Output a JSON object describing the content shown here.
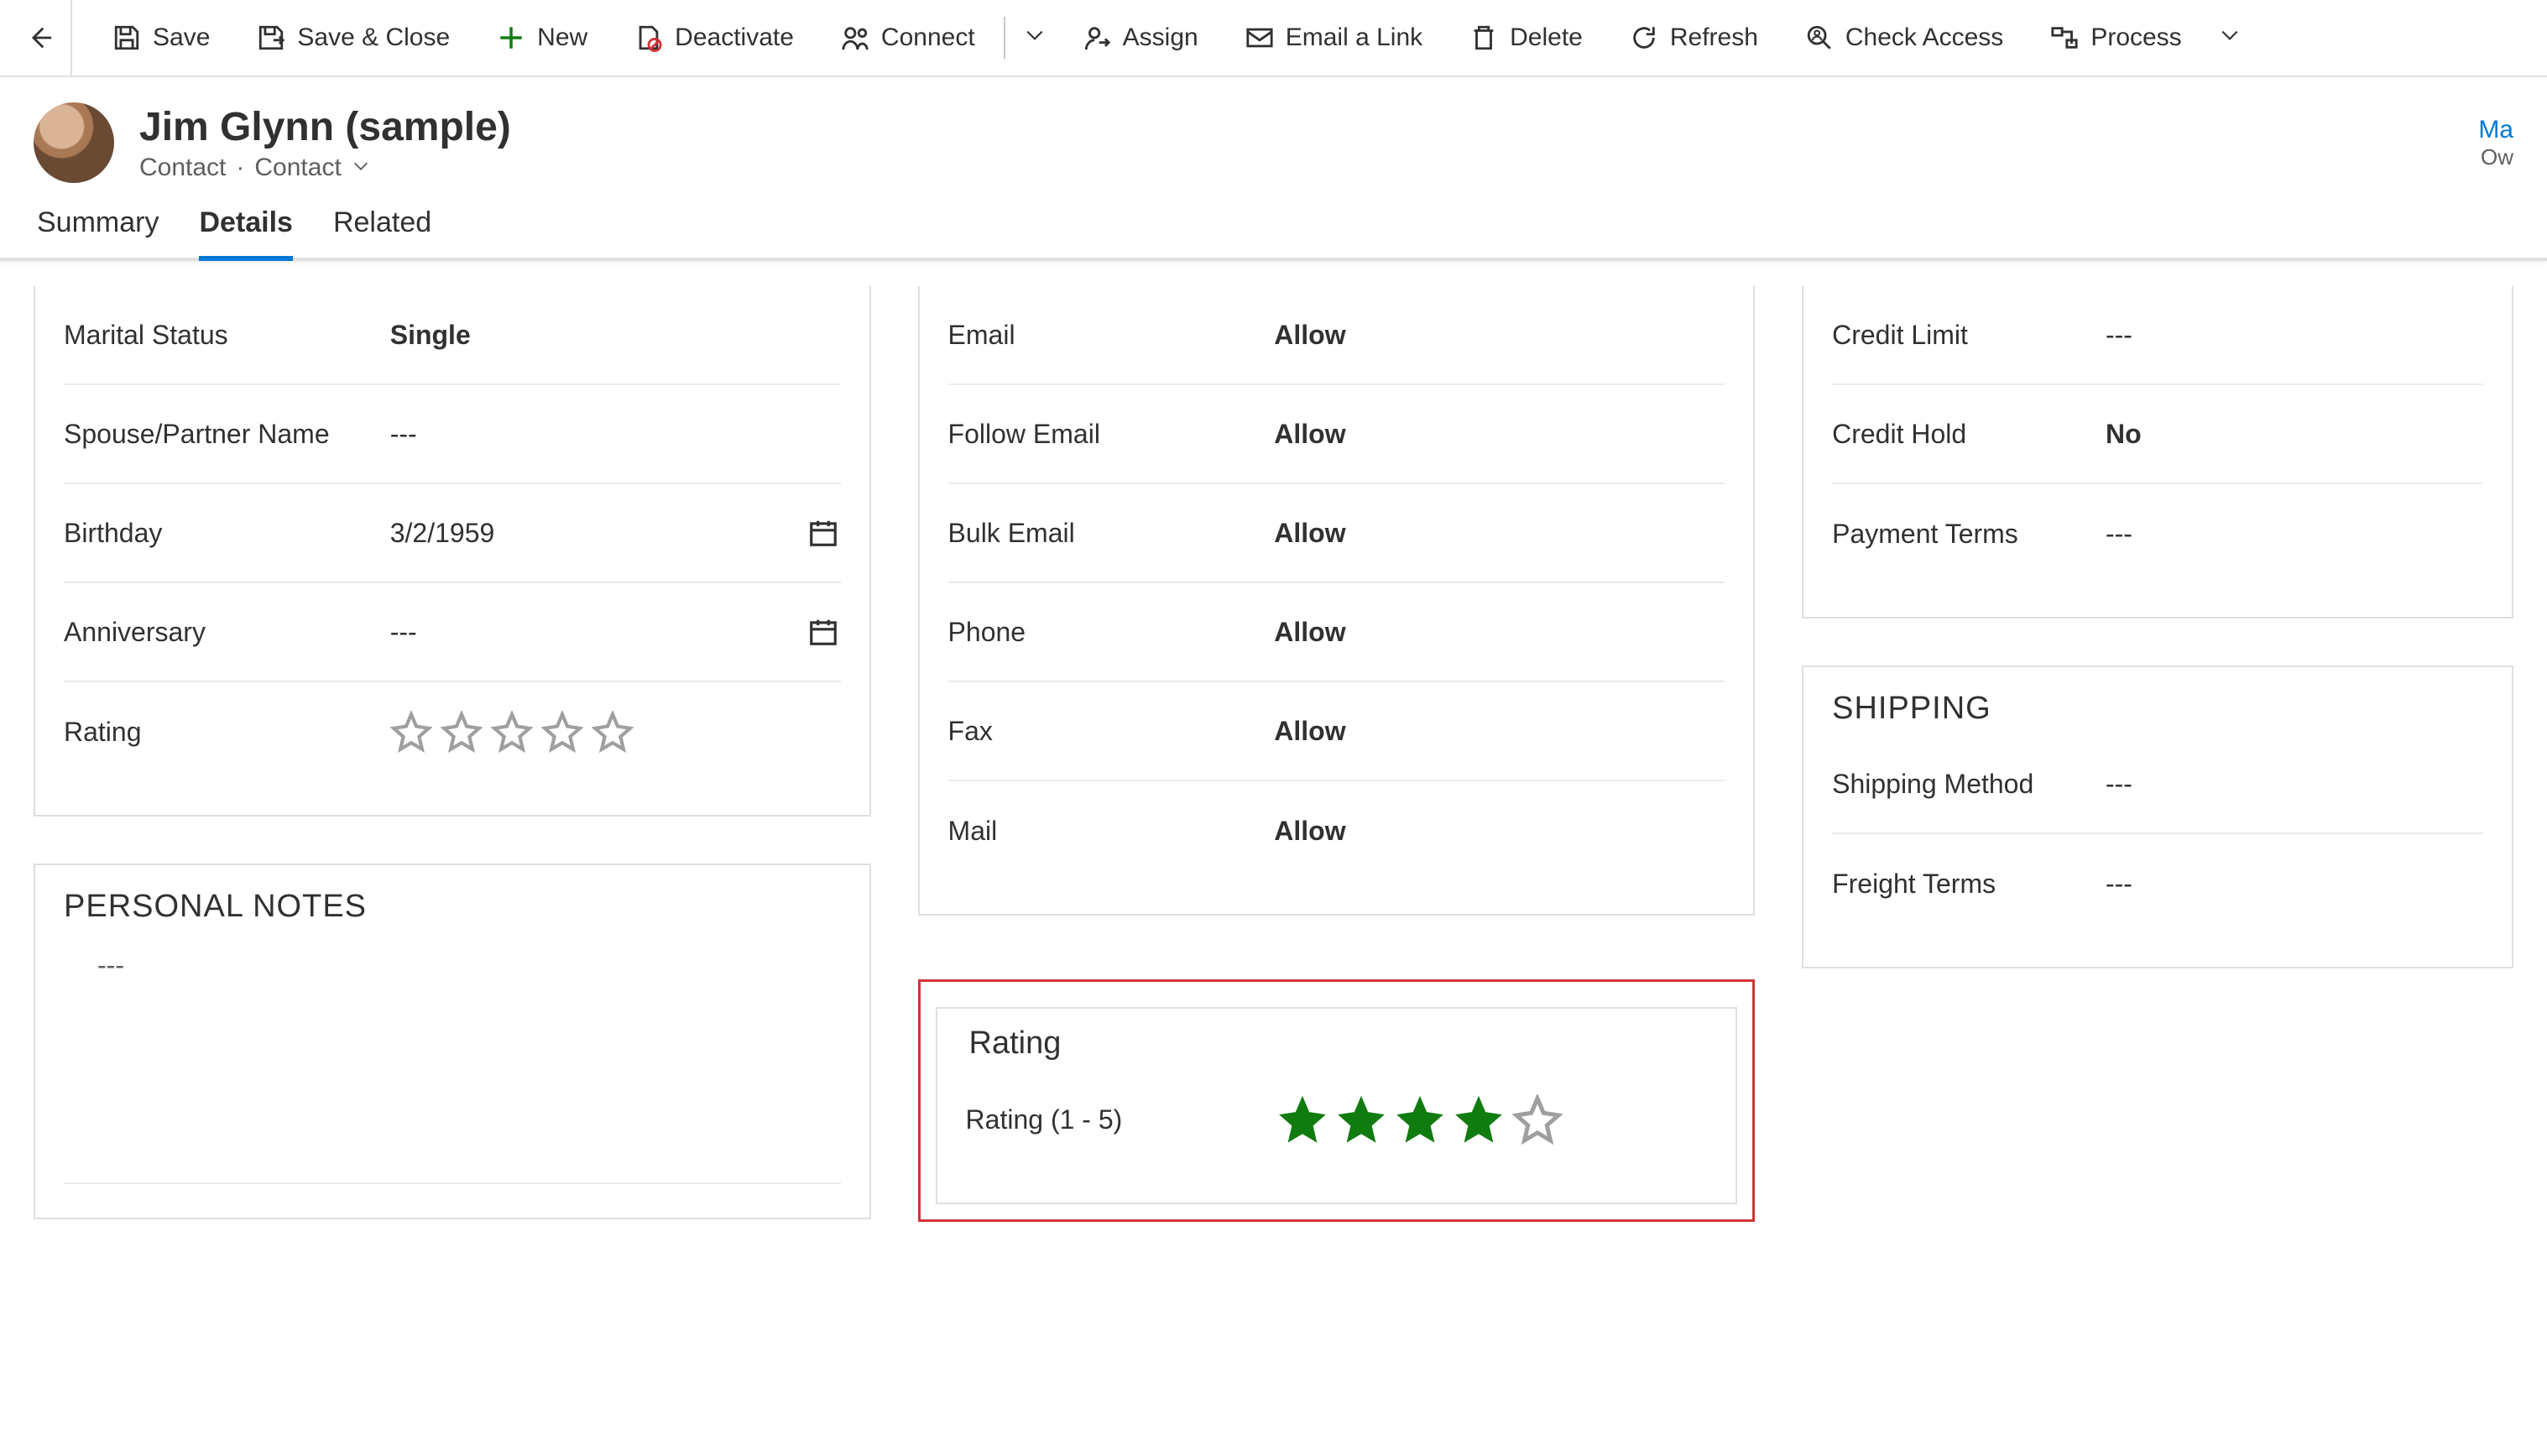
{
  "commandbar": {
    "save": "Save",
    "save_close": "Save & Close",
    "new": "New",
    "deactivate": "Deactivate",
    "connect": "Connect",
    "assign": "Assign",
    "email_link": "Email a Link",
    "delete": "Delete",
    "refresh": "Refresh",
    "check_access": "Check Access",
    "process": "Process"
  },
  "header": {
    "title": "Jim Glynn (sample)",
    "entity": "Contact",
    "form": "Contact",
    "owner_link": "Ma",
    "owner_label": "Ow"
  },
  "tabs": {
    "summary": "Summary",
    "details": "Details",
    "related": "Related"
  },
  "personal": {
    "marital_status_label": "Marital Status",
    "marital_status_value": "Single",
    "spouse_label": "Spouse/Partner Name",
    "spouse_value": "---",
    "birthday_label": "Birthday",
    "birthday_value": "3/2/1959",
    "anniversary_label": "Anniversary",
    "anniversary_value": "---",
    "rating_label": "Rating",
    "rating_value": 0
  },
  "personal_notes": {
    "title": "PERSONAL NOTES",
    "value": "---"
  },
  "contact_prefs": {
    "email_label": "Email",
    "email_value": "Allow",
    "follow_label": "Follow Email",
    "follow_value": "Allow",
    "bulk_label": "Bulk Email",
    "bulk_value": "Allow",
    "phone_label": "Phone",
    "phone_value": "Allow",
    "fax_label": "Fax",
    "fax_value": "Allow",
    "mail_label": "Mail",
    "mail_value": "Allow"
  },
  "rating_section": {
    "title": "Rating",
    "label": "Rating (1 - 5)",
    "value": 4
  },
  "billing": {
    "credit_limit_label": "Credit Limit",
    "credit_limit_value": "---",
    "credit_hold_label": "Credit Hold",
    "credit_hold_value": "No",
    "payment_terms_label": "Payment Terms",
    "payment_terms_value": "---"
  },
  "shipping": {
    "title": "SHIPPING",
    "method_label": "Shipping Method",
    "method_value": "---",
    "freight_label": "Freight Terms",
    "freight_value": "---"
  }
}
